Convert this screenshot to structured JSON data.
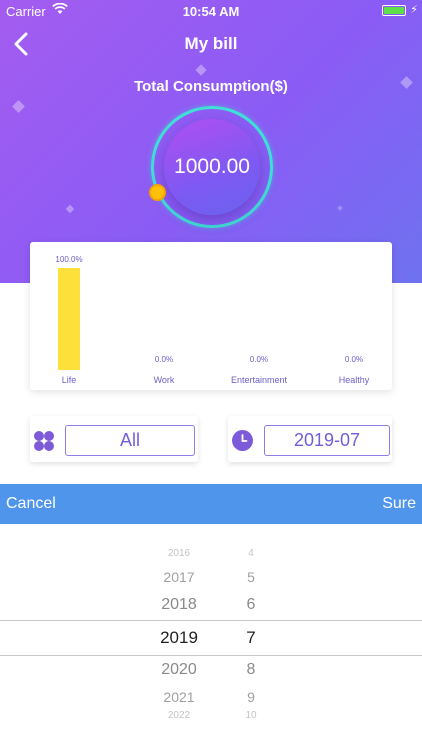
{
  "status_bar": {
    "carrier": "Carrier",
    "time": "10:54 AM"
  },
  "nav": {
    "title": "My bill",
    "back_icon": "chevron-left-icon"
  },
  "summary": {
    "label": "Total Consumption($)",
    "value": "1000.00"
  },
  "chart_data": {
    "type": "bar",
    "categories": [
      "Life",
      "Work",
      "Entertainment",
      "Healthy"
    ],
    "values": [
      100.0,
      0.0,
      0.0,
      0.0
    ],
    "value_labels": [
      "100.0%",
      "0.0%",
      "0.0%",
      "0.0%"
    ],
    "ylim": [
      0,
      100
    ],
    "grid": false,
    "bar_color": "#fde13a"
  },
  "filters": {
    "category": {
      "icon": "clover-icon",
      "value": "All"
    },
    "date": {
      "icon": "clock-icon",
      "value": "2019-07"
    }
  },
  "picker": {
    "cancel_label": "Cancel",
    "sure_label": "Sure",
    "years": [
      "2016",
      "2017",
      "2018",
      "2019",
      "2020",
      "2021",
      "2022"
    ],
    "months": [
      "4",
      "5",
      "6",
      "7",
      "8",
      "9",
      "10"
    ],
    "selected_year": "2019",
    "selected_month": "7"
  },
  "colors": {
    "accent": "#7b5cf4",
    "toolbar": "#4f95ec",
    "ring": "#3fe0d6",
    "knob": "#ffc107",
    "bar": "#fde13a"
  }
}
